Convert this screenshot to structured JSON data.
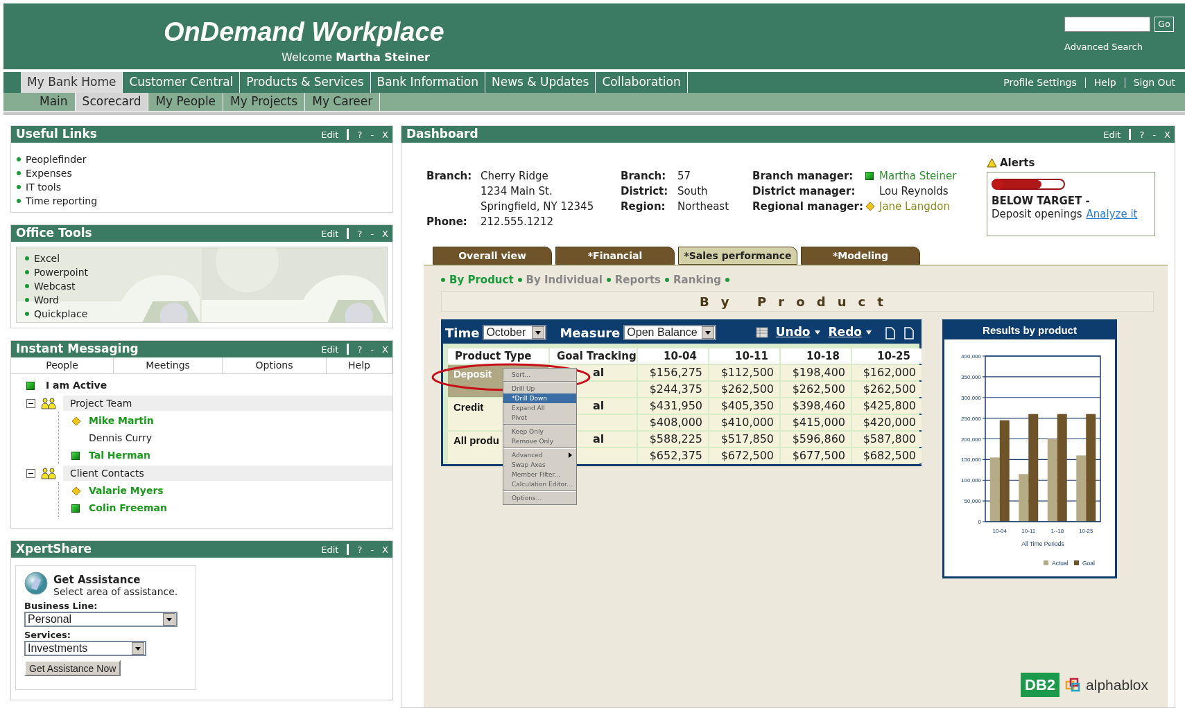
{
  "header": {
    "title": "OnDemand Workplace",
    "welcome": "Welcome **Martha Steiner**",
    "search": {
      "button": "Go",
      "link": "Advanced Search"
    }
  },
  "nav": {
    "tabs": [
      {
        "label": "My Bank Home",
        "selected": true
      },
      {
        "label": "Customer Central",
        "selected": false
      },
      {
        "label": "Products & Services",
        "selected": false
      },
      {
        "label": "Bank Information",
        "selected": false
      },
      {
        "label": "News & Updates",
        "selected": false
      },
      {
        "label": "Collaboration",
        "selected": false
      }
    ],
    "links": [
      "Profile Settings",
      "Help",
      "Sign Out"
    ]
  },
  "subnav": {
    "tabs": [
      {
        "label": "Main",
        "selected": false
      },
      {
        "label": "Scorecard",
        "selected": true
      },
      {
        "label": "My People",
        "selected": false
      },
      {
        "label": "My Projects",
        "selected": false
      },
      {
        "label": "My Career",
        "selected": false
      }
    ]
  },
  "panels": [
    {
      "kind": "links",
      "title": "Useful Links",
      "controls": [
        "Edit",
        "?",
        "-",
        "X"
      ],
      "items": [
        "Peoplefinder",
        "Expenses",
        "IT tools",
        "Time reporting"
      ]
    },
    {
      "kind": "tools",
      "title": "Office Tools",
      "controls": [
        "Edit",
        "?",
        "-",
        "X"
      ],
      "items": [
        "Excel",
        "Powerpoint",
        "Webcast",
        "Word",
        "Quickplace"
      ]
    },
    {
      "kind": "messaging",
      "title": "Instant Messaging",
      "controls": [
        "Edit",
        "?",
        "-",
        "X"
      ],
      "tabs": [
        "People",
        "Meetings",
        "Options",
        "Help"
      ],
      "me": {
        "name": "I am Active",
        "kind": "active"
      },
      "groups": [
        {
          "name": "Project Team",
          "expanded": true,
          "children": [
            {
              "name": "Mike Martin",
              "kind": "away"
            },
            {
              "name": "Dennis Curry",
              "kind": "offline"
            },
            {
              "name": "Tal Herman",
              "kind": "active"
            }
          ]
        },
        {
          "name": "Client Contacts",
          "expanded": true,
          "children": [
            {
              "name": "Valarie Myers",
              "kind": "away"
            },
            {
              "name": "Colin Freeman",
              "kind": "active"
            }
          ]
        }
      ]
    },
    {
      "kind": "assist",
      "title": "XpertShare",
      "controls": [
        "Edit",
        "?",
        "-",
        "X"
      ],
      "heading": "Get Assistance",
      "subheading": "Select area of assistance.",
      "fields": [
        {
          "label": "Business Line:",
          "value": "Personal"
        },
        {
          "label": "Services:",
          "value": "Investments"
        }
      ],
      "button": "Get Assistance Now"
    }
  ],
  "dashboard": {
    "title": "Dashboard",
    "controls": [
      "Edit",
      "?",
      "-",
      "X"
    ],
    "info": [
      [
        {
          "label": "Branch:",
          "lines": [
            "Cherry Ridge",
            "1234 Main St.",
            "Springfield, NY 12345"
          ]
        },
        {
          "label": "Phone:",
          "lines": [
            "212.555.1212"
          ]
        }
      ],
      [
        {
          "label": "Branch:",
          "lines": [
            "57"
          ]
        },
        {
          "label": "District:",
          "lines": [
            "South"
          ]
        },
        {
          "label": "Region:",
          "lines": [
            "Northeast"
          ]
        }
      ],
      [
        {
          "label": "Branch manager:",
          "lines": [
            "Martha Steiner"
          ],
          "kind": "active"
        },
        {
          "label": "District manager:",
          "lines": [
            "Lou Reynolds"
          ],
          "kind": "offline"
        },
        {
          "label": "Regional manager:",
          "lines": [
            "Jane Langdon"
          ],
          "kind": "away"
        }
      ]
    ],
    "alerts": {
      "title": "Alerts",
      "heading": "BELOW TARGET -",
      "text": "Deposit openings",
      "link": "Analyze it"
    },
    "tabs": [
      {
        "label": "Overall view",
        "selected": false
      },
      {
        "label": "*Financial",
        "selected": false
      },
      {
        "label": "*Sales performance",
        "selected": true
      },
      {
        "label": "*Modeling",
        "selected": false
      }
    ],
    "views": [
      {
        "label": "By Product",
        "selected": true
      },
      {
        "label": "By Individual",
        "selected": false
      },
      {
        "label": "Reports",
        "selected": false
      },
      {
        "label": "Ranking",
        "selected": false
      }
    ],
    "view_title": "By Product",
    "toolbar": {
      "time_label": "Time",
      "time": "October",
      "measure_label": "Measure",
      "measure": "Open Balance",
      "undo": "Undo",
      "redo": "Redo"
    },
    "table": {
      "columns": [
        "Product Type",
        "Goal Tracking",
        "10-04",
        "10-11",
        "10-18",
        "10-25"
      ],
      "groups": [
        {
          "product": "Deposit",
          "selected": true,
          "rows": [
            {
              "goal": "al",
              "values": [
                "$156,275",
                "$112,500",
                "$198,400",
                "$162,000"
              ]
            },
            {
              "values": [
                "$244,375",
                "$262,500",
                "$262,500",
                "$262,500"
              ]
            }
          ]
        },
        {
          "product": "Credit",
          "selected": false,
          "rows": [
            {
              "goal": "al",
              "values": [
                "$431,950",
                "$405,350",
                "$398,460",
                "$425,800"
              ]
            },
            {
              "values": [
                "$408,000",
                "$410,000",
                "$415,000",
                "$420,000"
              ]
            }
          ]
        },
        {
          "product": "All produ",
          "selected": false,
          "rows": [
            {
              "goal": "al",
              "values": [
                "$588,225",
                "$517,850",
                "$596,860",
                "$587,800"
              ]
            },
            {
              "values": [
                "$652,375",
                "$672,500",
                "$677,500",
                "$682,500"
              ]
            }
          ]
        }
      ]
    },
    "context_menu": {
      "groups": [
        [
          {
            "label": "Sort...",
            "selected": false,
            "submenu": false
          }
        ],
        [
          {
            "label": "Drill Up",
            "selected": false,
            "submenu": false
          },
          {
            "label": "*Drill Down",
            "selected": true,
            "submenu": false
          },
          {
            "label": "Expand All",
            "selected": false,
            "submenu": false
          },
          {
            "label": "Pivot",
            "selected": false,
            "submenu": false
          }
        ],
        [
          {
            "label": "Keep Only",
            "selected": false,
            "submenu": false
          },
          {
            "label": "Remove Only",
            "selected": false,
            "submenu": false
          }
        ],
        [
          {
            "label": "Advanced",
            "selected": false,
            "submenu": true
          },
          {
            "label": "Swap Axes",
            "selected": false,
            "submenu": false
          },
          {
            "label": "Member Filter...",
            "selected": false,
            "submenu": false
          },
          {
            "label": "Calculation Editor...",
            "selected": false,
            "submenu": false
          }
        ],
        [
          {
            "label": "Options...",
            "selected": false,
            "submenu": false
          }
        ]
      ]
    },
    "chart": {
      "title": "Results by product",
      "chart_data": {
        "type": "bar",
        "xlabel": "All Time Periods",
        "categories": [
          "10-04",
          "10-11",
          "1--18",
          "10-25"
        ],
        "series": [
          {
            "name": "Actual",
            "color": "#b5ab85",
            "values": [
              155000,
              115000,
              200000,
              160000
            ]
          },
          {
            "name": "Goal",
            "color": "#6e5428",
            "values": [
              245000,
              260000,
              260000,
              260000
            ]
          }
        ],
        "ylim": [
          0,
          400000
        ],
        "grid": true,
        "legend": true,
        "yticks": [
          {
            "value": 0,
            "label": "0"
          },
          {
            "value": 50000,
            "label": "50,000"
          },
          {
            "value": 100000,
            "label": "100,000"
          },
          {
            "value": 150000,
            "label": "150,000"
          },
          {
            "value": 200000,
            "label": "200,000"
          },
          {
            "value": 250000,
            "label": "250,000"
          },
          {
            "value": 300000,
            "label": "300,000"
          },
          {
            "value": 350000,
            "label": "350,000"
          },
          {
            "value": 400000,
            "label": "400,000"
          }
        ]
      }
    },
    "logos": {
      "badge": "DB2",
      "brand": "alphablox"
    }
  }
}
